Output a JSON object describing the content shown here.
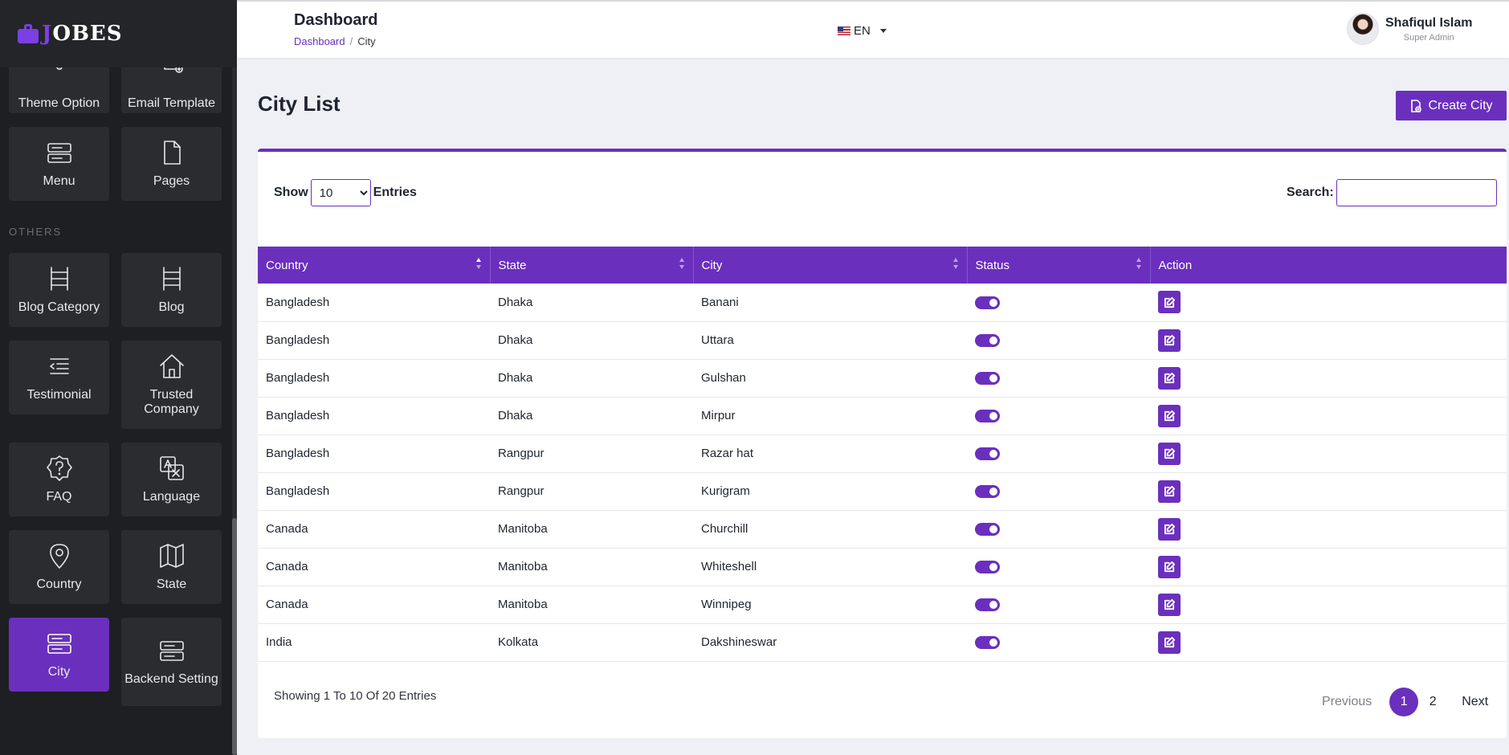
{
  "brand": {
    "first_letter": "J",
    "rest": "OBES"
  },
  "sidebar": {
    "others_label": "OTHERS",
    "tiles": [
      {
        "label": "Theme Option",
        "icon": "brush-icon"
      },
      {
        "label": "Email Template",
        "icon": "email-template-icon"
      },
      {
        "label": "Menu",
        "icon": "menu-icon"
      },
      {
        "label": "Pages",
        "icon": "page-icon"
      },
      {
        "label": "Blog Category",
        "icon": "ladder-icon"
      },
      {
        "label": "Blog",
        "icon": "ladder-icon"
      },
      {
        "label": "Testimonial",
        "icon": "quote-list-icon"
      },
      {
        "label": "Trusted Company",
        "icon": "home-icon"
      },
      {
        "label": "FAQ",
        "icon": "question-icon"
      },
      {
        "label": "Language",
        "icon": "translate-icon"
      },
      {
        "label": "Country",
        "icon": "map-pin-icon"
      },
      {
        "label": "State",
        "icon": "map-icon"
      },
      {
        "label": "City",
        "icon": "server-icon",
        "active": true
      },
      {
        "label": "Backend Setting",
        "icon": "server-icon"
      }
    ]
  },
  "header": {
    "title": "Dashboard",
    "breadcrumb": {
      "link": "Dashboard",
      "sep": "/",
      "current": "City"
    },
    "language": "EN",
    "user": {
      "name": "Shafiqul Islam",
      "role": "Super Admin"
    }
  },
  "main": {
    "title": "City List",
    "create_label": "Create City",
    "show_label": "Show",
    "entries_label": "Entries",
    "page_size": "10",
    "search_label": "Search:",
    "columns": [
      "Country",
      "State",
      "City",
      "Status",
      "Action"
    ],
    "rows": [
      [
        "Bangladesh",
        "Dhaka",
        "Banani"
      ],
      [
        "Bangladesh",
        "Dhaka",
        "Uttara"
      ],
      [
        "Bangladesh",
        "Dhaka",
        "Gulshan"
      ],
      [
        "Bangladesh",
        "Dhaka",
        "Mirpur"
      ],
      [
        "Bangladesh",
        "Rangpur",
        "Razar hat"
      ],
      [
        "Bangladesh",
        "Rangpur",
        "Kurigram"
      ],
      [
        "Canada",
        "Manitoba",
        "Churchill"
      ],
      [
        "Canada",
        "Manitoba",
        "Whiteshell"
      ],
      [
        "Canada",
        "Manitoba",
        "Winnipeg"
      ],
      [
        "India",
        "Kolkata",
        "Dakshineswar"
      ]
    ],
    "info": "Showing 1 To 10 Of 20 Entries",
    "pagination": {
      "prev": "Previous",
      "pages": [
        "1",
        "2"
      ],
      "current": "1",
      "next": "Next"
    }
  },
  "colors": {
    "accent": "#6b2fbd",
    "sidebar_bg": "#1e1f22",
    "tile_bg": "#2b2c30"
  }
}
